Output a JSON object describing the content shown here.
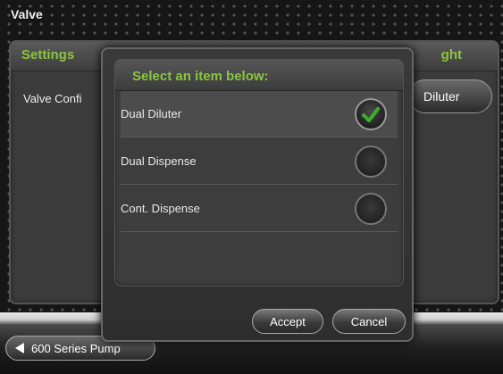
{
  "window": {
    "title": "Valve"
  },
  "background": {
    "settings_header": "Settings",
    "right_header": "ght",
    "valve_label": "Valve Confi",
    "valve_button": "Diluter"
  },
  "dialog": {
    "header": "Select an item below:",
    "items": [
      {
        "label": "Dual Diluter",
        "selected": true
      },
      {
        "label": "Dual Dispense",
        "selected": false
      },
      {
        "label": "Cont. Dispense",
        "selected": false
      }
    ],
    "accept_label": "Accept",
    "cancel_label": "Cancel"
  },
  "footer": {
    "back_label": "600 Series Pump"
  },
  "colors": {
    "accent_green": "#8bc63f",
    "check_green": "#3fae2a"
  }
}
